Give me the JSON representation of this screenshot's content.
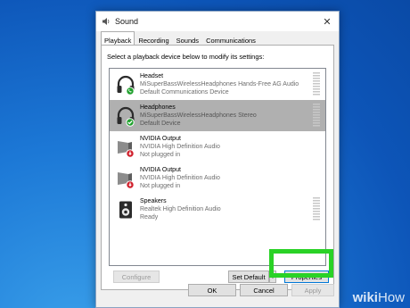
{
  "window": {
    "title": "Sound",
    "close_symbol": "✕"
  },
  "tabs": [
    {
      "label": "Playback",
      "active": true
    },
    {
      "label": "Recording",
      "active": false
    },
    {
      "label": "Sounds",
      "active": false
    },
    {
      "label": "Communications",
      "active": false
    }
  ],
  "instructions": "Select a playback device below to modify its settings:",
  "devices": [
    {
      "name": "Headset",
      "description": "MiSuperBassWirelessHeadphones Hands-Free AG Audio",
      "status": "Default Communications Device",
      "icon": "headset-icon",
      "badge": "phone",
      "selected": false
    },
    {
      "name": "Headphones",
      "description": "MiSuperBassWirelessHeadphones Stereo",
      "status": "Default Device",
      "icon": "headphones-icon",
      "badge": "check",
      "selected": true
    },
    {
      "name": "NVIDIA Output",
      "description": "NVIDIA High Definition Audio",
      "status": "Not plugged in",
      "icon": "monitor-speaker-icon",
      "badge": "unplugged",
      "selected": false
    },
    {
      "name": "NVIDIA Output",
      "description": "NVIDIA High Definition Audio",
      "status": "Not plugged in",
      "icon": "monitor-speaker-icon",
      "badge": "unplugged",
      "selected": false
    },
    {
      "name": "Speakers",
      "description": "Realtek High Definition Audio",
      "status": "Ready",
      "icon": "speaker-icon",
      "badge": "none",
      "selected": false
    }
  ],
  "buttons": {
    "configure": "Configure",
    "set_default": "Set Default",
    "properties": "Properties",
    "ok": "OK",
    "cancel": "Cancel",
    "apply": "Apply"
  },
  "watermark": {
    "bold": "wiki",
    "light": "How"
  },
  "colors": {
    "desktop": "#1c78d6",
    "highlight": "#2ad226",
    "selected_row": "#b0b0b0",
    "badge_green": "#1fa02c",
    "badge_red": "#d0202c"
  }
}
